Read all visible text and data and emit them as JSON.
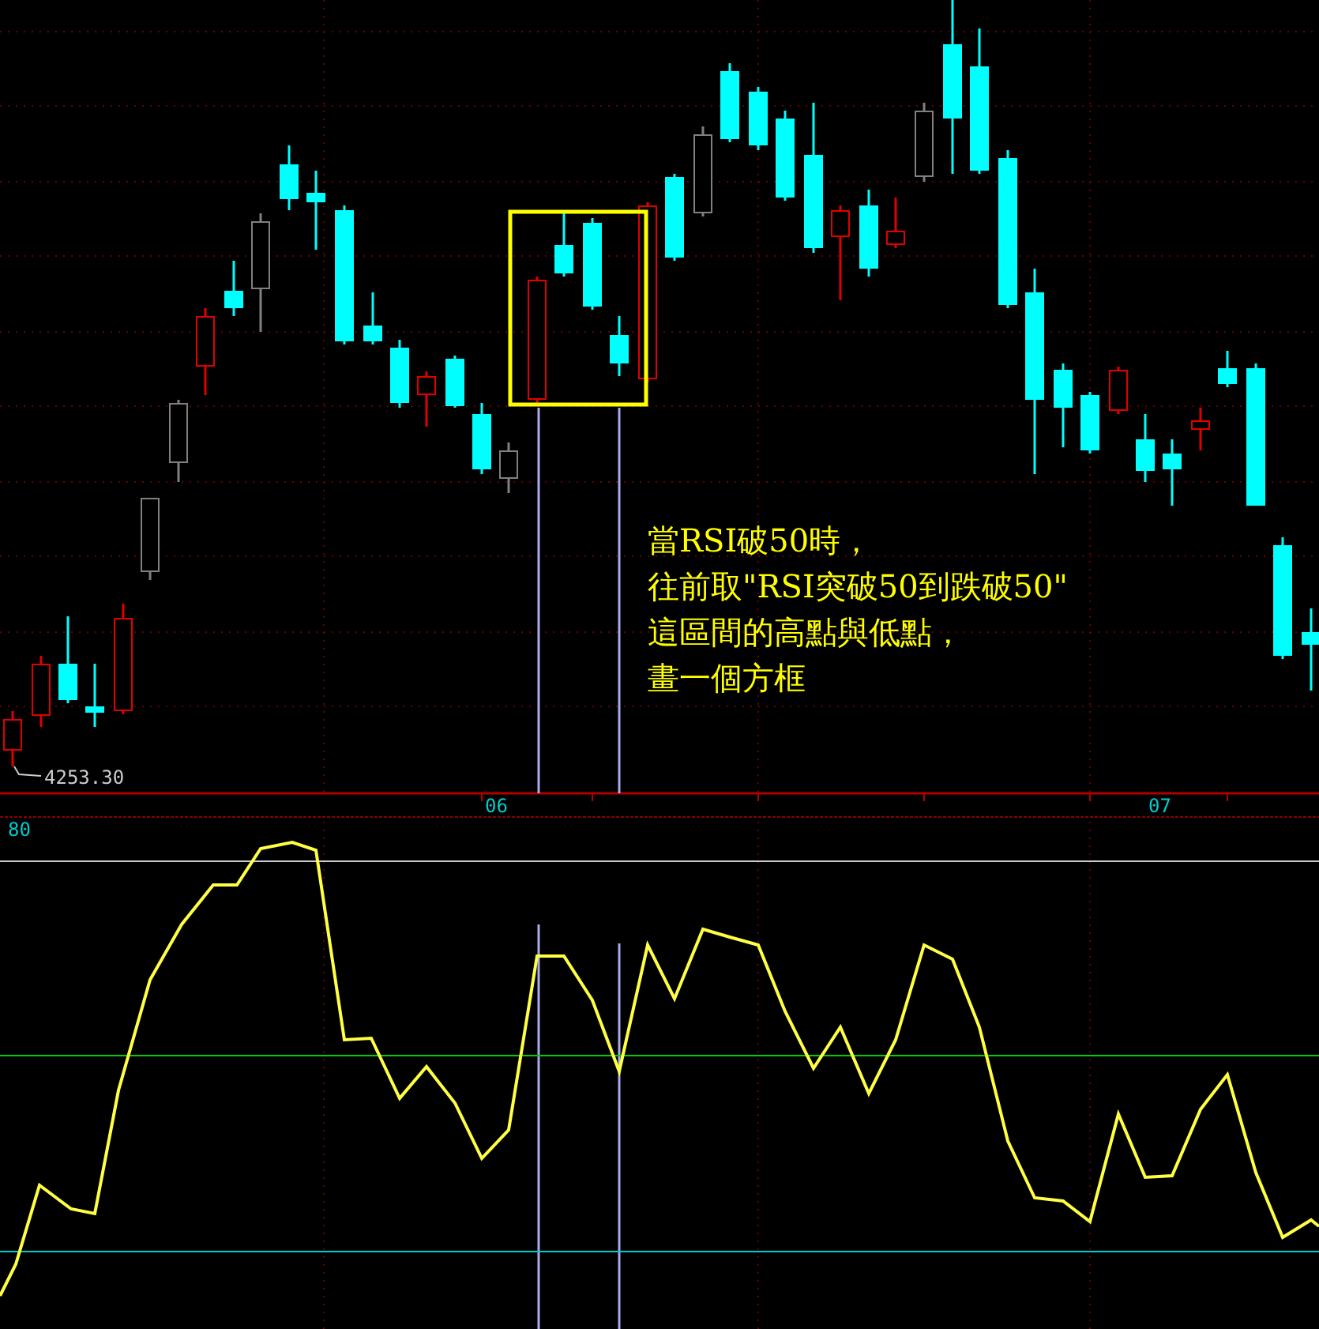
{
  "price_panel": {
    "low_label": "4253.30",
    "annotation": [
      "當RSI破50時，",
      "往前取\"RSI突破50到跌破50\"",
      "這區間的高點與低點，",
      "畫一個方框"
    ]
  },
  "time_axis": {
    "labels": [
      "06",
      "07"
    ]
  },
  "rsi_panel": {
    "scale_label": "80"
  }
}
